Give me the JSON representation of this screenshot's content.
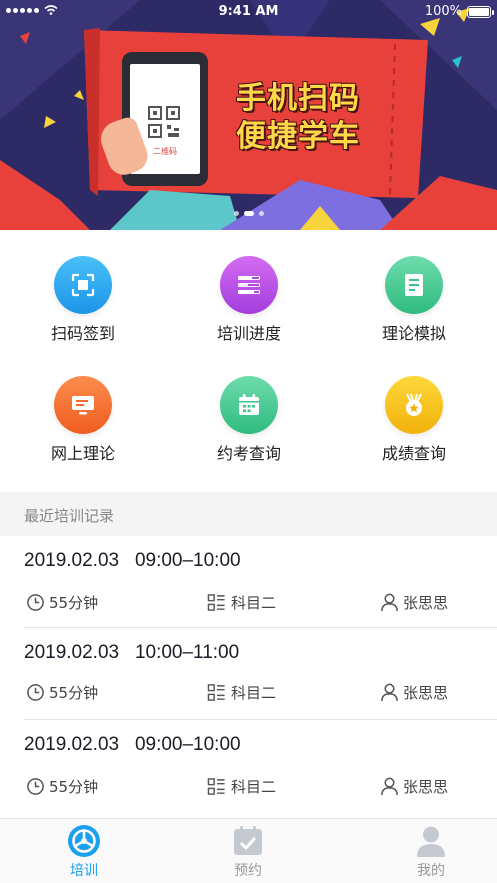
{
  "status_bar": {
    "time": "9:41 AM",
    "battery": "100%"
  },
  "banner": {
    "slogan_line1": "手机扫码",
    "slogan_line2": "便捷学车",
    "qr_caption": "二维码",
    "slides": 3,
    "active_slide": 2
  },
  "features": [
    {
      "label": "扫码签到",
      "icon": "scan-icon",
      "color": "#29a8f0"
    },
    {
      "label": "培训进度",
      "icon": "progress-icon",
      "color": "#b54be6"
    },
    {
      "label": "理论模拟",
      "icon": "document-icon",
      "color": "#3cc58a"
    },
    {
      "label": "网上理论",
      "icon": "monitor-icon",
      "color": "#f36a2c"
    },
    {
      "label": "约考查询",
      "icon": "calendar-icon",
      "color": "#3cc58a"
    },
    {
      "label": "成绩查询",
      "icon": "medal-icon",
      "color": "#f7c81c"
    }
  ],
  "records_section": {
    "title": "最近培训记录"
  },
  "records": [
    {
      "date": "2019.02.03",
      "time": "09:00–10:00",
      "duration": "55分钟",
      "subject": "科目二",
      "coach": "张思思"
    },
    {
      "date": "2019.02.03",
      "time": "10:00–11:00",
      "duration": "55分钟",
      "subject": "科目二",
      "coach": "张思思"
    },
    {
      "date": "2019.02.03",
      "time": "09:00–10:00",
      "duration": "55分钟",
      "subject": "科目二",
      "coach": "张思思"
    }
  ],
  "tabbar": [
    {
      "label": "培训",
      "icon": "steering-wheel-icon",
      "active": true
    },
    {
      "label": "预约",
      "icon": "calendar-check-icon",
      "active": false
    },
    {
      "label": "我的",
      "icon": "user-icon",
      "active": false
    }
  ],
  "colors": {
    "accent": "#1b9ff0",
    "banner_bg": "#2e2a66",
    "ticket_red": "#e8413c",
    "slogan_yellow": "#ffd84a"
  }
}
